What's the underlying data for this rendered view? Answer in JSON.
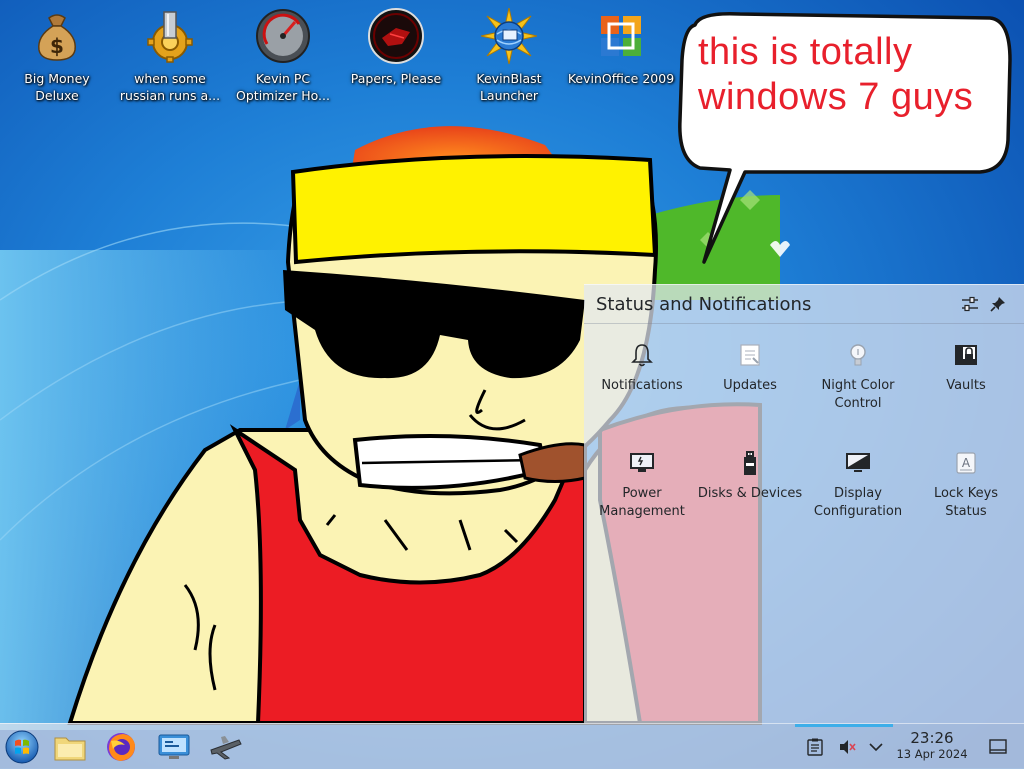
{
  "desktop": {
    "icons": [
      {
        "label": "Big Money Deluxe",
        "icon": "money-bag-icon"
      },
      {
        "label": "when some russian runs a...",
        "icon": "gear-icon"
      },
      {
        "label": "Kevin PC Optimizer Ho...",
        "icon": "gauge-icon"
      },
      {
        "label": "Papers, Please",
        "icon": "papers-please-icon"
      },
      {
        "label": "KevinBlast Launcher",
        "icon": "globe-burst-icon"
      },
      {
        "label": "KevinOffice 2009",
        "icon": "office-logo-icon"
      }
    ],
    "bubble_text": "this is totally windows 7 guys"
  },
  "popup": {
    "title": "Status and Notifications",
    "items": [
      {
        "label": "Notifications",
        "icon": "bell-icon"
      },
      {
        "label": "Updates",
        "icon": "updates-icon"
      },
      {
        "label": "Night Color Control",
        "icon": "lightbulb-icon"
      },
      {
        "label": "Vaults",
        "icon": "vault-lock-icon"
      },
      {
        "label": "Power Management",
        "icon": "battery-monitor-icon"
      },
      {
        "label": "Disks & Devices",
        "icon": "usb-drive-icon"
      },
      {
        "label": "Display Configuration",
        "icon": "display-icon"
      },
      {
        "label": "Lock Keys Status",
        "icon": "lock-key-icon"
      }
    ]
  },
  "taskbar": {
    "time": "23:26",
    "date": "13 Apr 2024",
    "launchers": [
      "start-orb-icon",
      "file-manager-icon",
      "firefox-icon",
      "system-settings-icon",
      "plane-app-icon"
    ]
  },
  "colors": {
    "accent": "#3daee9",
    "bubble_text": "#e8202c",
    "sky": "#1565c0"
  }
}
